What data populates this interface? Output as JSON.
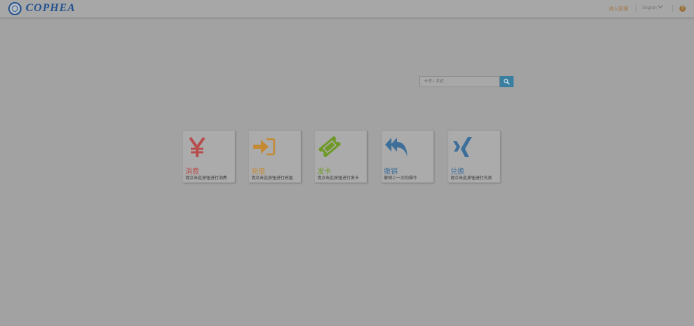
{
  "header": {
    "logo_text": "COPHEA",
    "nav_link": "进入管理",
    "language": "Engnsh",
    "help_glyph": "?"
  },
  "search": {
    "placeholder": "卡号 / 手机"
  },
  "tiles": [
    {
      "title": "消费",
      "desc": "请点击此按钮进行消费",
      "icon": "yen-icon",
      "color": "#b84d4d"
    },
    {
      "title": "充值",
      "desc": "请点击此按钮进行充值",
      "icon": "sign-in-icon",
      "color": "#c48a33"
    },
    {
      "title": "发卡",
      "desc": "请点击此按钮进行发卡",
      "icon": "ticket-icon",
      "color": "#6f9a29"
    },
    {
      "title": "撤销",
      "desc": "撤销上一次的操作",
      "icon": "reply-all-icon",
      "color": "#3d6f9a"
    },
    {
      "title": "兑换",
      "desc": "请点击此按钮进行兑换",
      "icon": "xing-icon",
      "color": "#3d6f9a"
    }
  ]
}
